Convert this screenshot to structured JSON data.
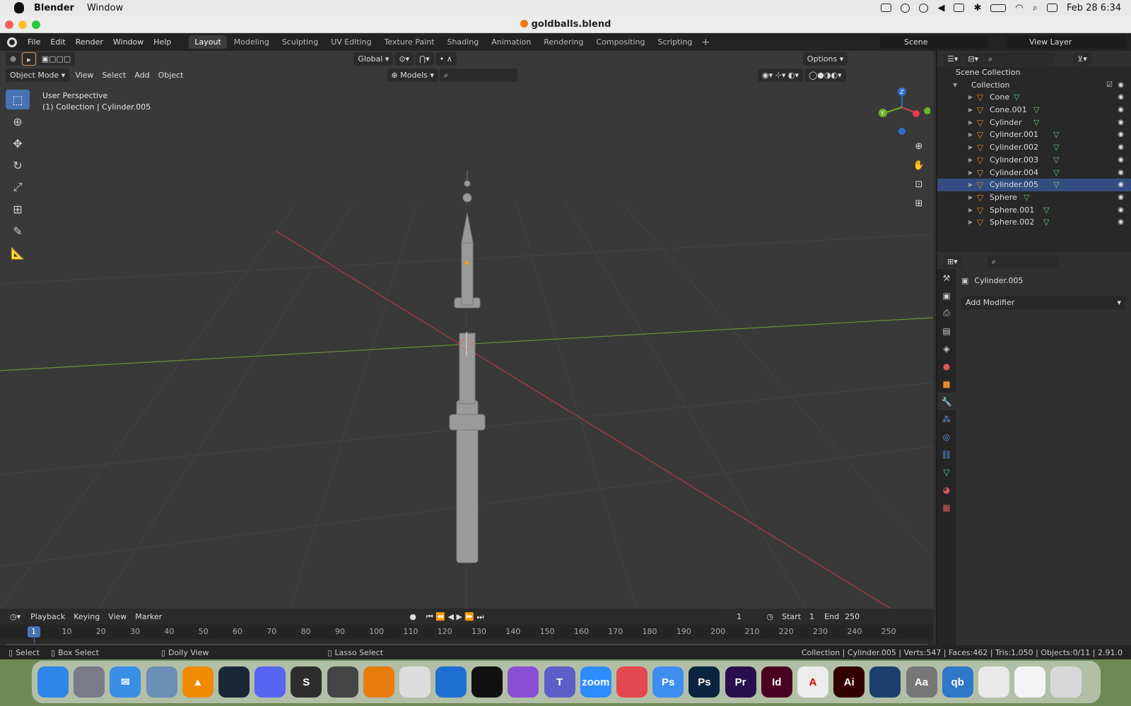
{
  "macbar": {
    "app": "Blender",
    "menu": [
      "Window"
    ],
    "datetime": "Feb 28  6:34"
  },
  "window": {
    "title": "goldballs.blend"
  },
  "topbar": {
    "menus": [
      "File",
      "Edit",
      "Render",
      "Window",
      "Help"
    ],
    "workspaces": [
      "Layout",
      "Modeling",
      "Sculpting",
      "UV Editing",
      "Texture Paint",
      "Shading",
      "Animation",
      "Rendering",
      "Compositing",
      "Scripting"
    ],
    "active_workspace": "Layout",
    "scene": "Scene",
    "view_layer": "View Layer"
  },
  "viewport": {
    "transform_orientation": "Global",
    "options": "Options",
    "mode": "Object Mode",
    "menus": [
      "View",
      "Select",
      "Add",
      "Object"
    ],
    "collection_filter": "Models",
    "overlay_line1": "User Perspective",
    "overlay_line2": "(1) Collection | Cylinder.005"
  },
  "outliner": {
    "root": "Scene Collection",
    "collection": "Collection",
    "items": [
      {
        "name": "Cone"
      },
      {
        "name": "Cone.001"
      },
      {
        "name": "Cylinder"
      },
      {
        "name": "Cylinder.001"
      },
      {
        "name": "Cylinder.002"
      },
      {
        "name": "Cylinder.003"
      },
      {
        "name": "Cylinder.004"
      },
      {
        "name": "Cylinder.005",
        "selected": true
      },
      {
        "name": "Sphere"
      },
      {
        "name": "Sphere.001"
      },
      {
        "name": "Sphere.002"
      }
    ]
  },
  "properties": {
    "object": "Cylinder.005",
    "add_modifier": "Add Modifier"
  },
  "timeline": {
    "menus": [
      "Playback",
      "Keying",
      "View",
      "Marker"
    ],
    "current_frame": "1",
    "start_label": "Start",
    "start": "1",
    "end_label": "End",
    "end": "250",
    "ticks": [
      "1",
      "10",
      "20",
      "30",
      "40",
      "50",
      "60",
      "70",
      "80",
      "90",
      "100",
      "110",
      "120",
      "130",
      "140",
      "150",
      "160",
      "170",
      "180",
      "190",
      "200",
      "210",
      "220",
      "230",
      "240",
      "250"
    ]
  },
  "statusbar": {
    "select": "Select",
    "box_select": "Box Select",
    "dolly": "Dolly View",
    "lasso": "Lasso Select",
    "stats": "Collection | Cylinder.005 | Verts:547 | Faces:462 | Tris:1,050 | Objects:0/11 | 2.91.0"
  },
  "dock": {
    "apps": [
      {
        "name": "finder",
        "label": "",
        "color": "#2e86e8"
      },
      {
        "name": "launchpad",
        "label": "",
        "color": "#7a7a8a"
      },
      {
        "name": "mail",
        "label": "✉",
        "color": "#3a8ee6"
      },
      {
        "name": "preview",
        "label": "",
        "color": "#6b8fb5"
      },
      {
        "name": "vlc",
        "label": "▲",
        "color": "#f08a00"
      },
      {
        "name": "steam",
        "label": "",
        "color": "#1b2838"
      },
      {
        "name": "discord",
        "label": "",
        "color": "#5865f2"
      },
      {
        "name": "sublime",
        "label": "S",
        "color": "#2d2d2d"
      },
      {
        "name": "unity",
        "label": "",
        "color": "#444"
      },
      {
        "name": "blender",
        "label": "",
        "color": "#e87d0d"
      },
      {
        "name": "cursor",
        "label": "",
        "color": "#ddd"
      },
      {
        "name": "vscode",
        "label": "",
        "color": "#1f6fd1"
      },
      {
        "name": "app-black",
        "label": "",
        "color": "#111"
      },
      {
        "name": "github-desktop",
        "label": "",
        "color": "#8a4fd3"
      },
      {
        "name": "teams",
        "label": "T",
        "color": "#5b5fc7"
      },
      {
        "name": "zoom",
        "label": "zoom",
        "color": "#2d8cff"
      },
      {
        "name": "creative-cloud",
        "label": "",
        "color": "#e34850"
      },
      {
        "name": "photoshop-express",
        "label": "Ps",
        "color": "#3d8eef"
      },
      {
        "name": "photoshop",
        "label": "Ps",
        "color": "#0b2540"
      },
      {
        "name": "premiere",
        "label": "Pr",
        "color": "#2a0f4f"
      },
      {
        "name": "indesign",
        "label": "Id",
        "color": "#49021f"
      },
      {
        "name": "acrobat",
        "label": "A",
        "color": "#ececec"
      },
      {
        "name": "illustrator",
        "label": "Ai",
        "color": "#330000"
      },
      {
        "name": "quicktime",
        "label": "",
        "color": "#1c3f6e"
      },
      {
        "name": "font-book",
        "label": "Aa",
        "color": "#777"
      },
      {
        "name": "qbittorrent",
        "label": "qb",
        "color": "#2f77c9"
      },
      {
        "name": "chrome",
        "label": "",
        "color": "#e9e9e9"
      },
      {
        "name": "window-thumbnail",
        "label": "",
        "color": "#f4f4f4"
      },
      {
        "name": "trash",
        "label": "",
        "color": "#d8d8d8"
      }
    ]
  }
}
